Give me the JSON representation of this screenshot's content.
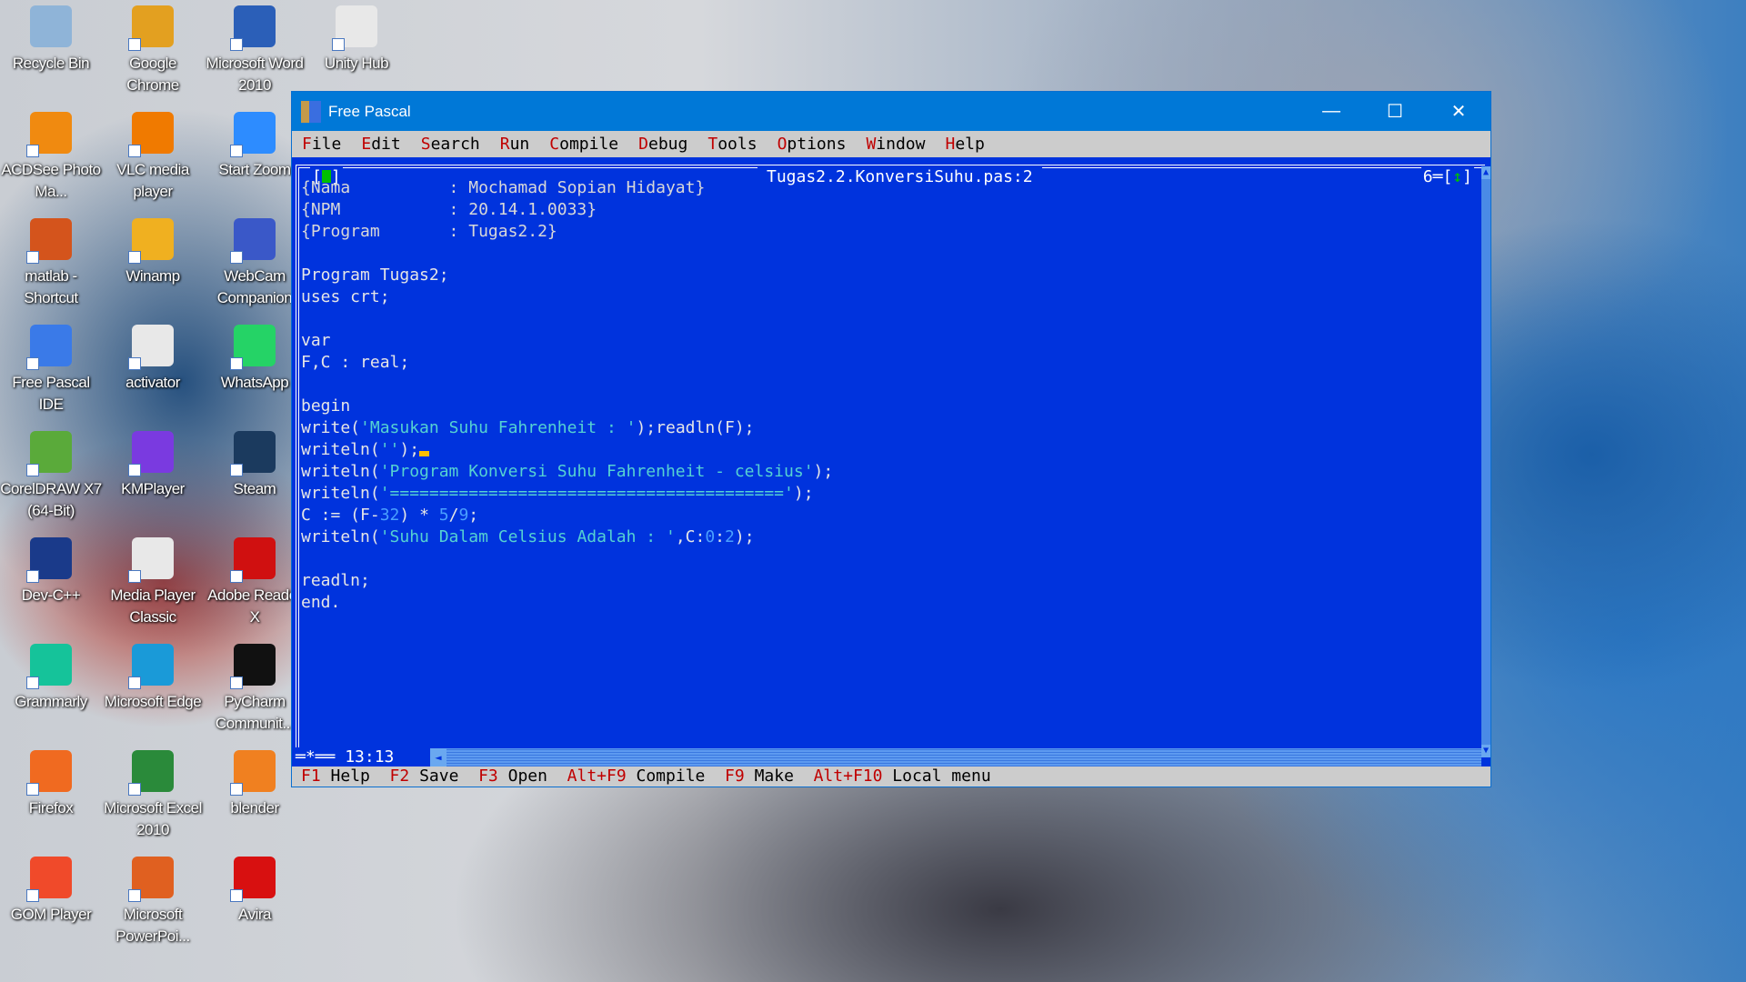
{
  "desktop": {
    "icons": [
      [
        "Recycle Bin",
        "#8fb4d8",
        "recycle-bin"
      ],
      [
        "Google Chrome",
        "#e3a020",
        "chrome"
      ],
      [
        "Microsoft Word 2010",
        "#2b5fb8",
        "word"
      ],
      [
        "Unity Hub",
        "#e8e8e8",
        "unity-hub"
      ],
      [
        "ACDSee Photo Ma...",
        "#f08a10",
        "acdsee"
      ],
      [
        "VLC media player",
        "#f07a00",
        "vlc"
      ],
      [
        "Start Zoom",
        "#2d8cff",
        "zoom"
      ],
      [
        "matlab - Shortcut",
        "#d4541c",
        "matlab"
      ],
      [
        "Winamp",
        "#f0b020",
        "winamp"
      ],
      [
        "WebCam Companion",
        "#3a58c8",
        "webcam"
      ],
      [
        "Free Pascal IDE",
        "#3a7ae8",
        "free-pascal"
      ],
      [
        "activator",
        "#e8e8e8",
        "activator"
      ],
      [
        "WhatsApp",
        "#25d366",
        "whatsapp"
      ],
      [
        "CorelDRAW X7 (64-Bit)",
        "#5aaa3a",
        "coreldraw"
      ],
      [
        "KMPlayer",
        "#7a3ae0",
        "kmplayer"
      ],
      [
        "Steam",
        "#1b3a5e",
        "steam"
      ],
      [
        "Dev-C++",
        "#1a3a8a",
        "devcpp"
      ],
      [
        "Media Player Classic",
        "#e8e8e8",
        "mpc"
      ],
      [
        "Adobe Reader X",
        "#d01010",
        "adobe-reader"
      ],
      [
        "Grammarly",
        "#15c39a",
        "grammarly"
      ],
      [
        "Microsoft Edge",
        "#1a9ad8",
        "edge"
      ],
      [
        "PyCharm Communit...",
        "#111111",
        "pycharm"
      ],
      [
        "Firefox",
        "#f06a20",
        "firefox"
      ],
      [
        "Microsoft Excel 2010",
        "#2a8a3a",
        "excel"
      ],
      [
        "blender",
        "#f08020",
        "blender"
      ],
      [
        "GOM Player",
        "#f04a2a",
        "gom-player"
      ],
      [
        "Microsoft PowerPoi...",
        "#e06020",
        "powerpoint"
      ],
      [
        "Avira",
        "#d81010",
        "avira"
      ]
    ]
  },
  "window": {
    "title": "Free Pascal",
    "minimize": "—",
    "maximize": "☐",
    "close": "✕"
  },
  "menu": [
    [
      "F",
      "ile"
    ],
    [
      "E",
      "dit"
    ],
    [
      "S",
      "earch"
    ],
    [
      "R",
      "un"
    ],
    [
      "C",
      "ompile"
    ],
    [
      "D",
      "ebug"
    ],
    [
      "T",
      "ools"
    ],
    [
      "O",
      "ptions"
    ],
    [
      "W",
      "indow"
    ],
    [
      "H",
      "elp"
    ]
  ],
  "editor": {
    "filename": "Tugas2.2.KonversiSuhu.pas:2",
    "window_number": "6",
    "cursor_position": "13:13",
    "lines": [
      [
        [
          "cmt",
          "{Nama          : Mochamad Sopian Hidayat}"
        ]
      ],
      [
        [
          "cmt",
          "{NPM           : 20.14.1.0033}"
        ]
      ],
      [
        [
          "cmt",
          "{Program       : Tugas2.2}"
        ]
      ],
      [],
      [
        [
          "t",
          "Program Tugas2;"
        ]
      ],
      [
        [
          "t",
          "uses crt;"
        ]
      ],
      [],
      [
        [
          "t",
          "var"
        ]
      ],
      [
        [
          "t",
          "F,C : real;"
        ]
      ],
      [],
      [
        [
          "t",
          "begin"
        ]
      ],
      [
        [
          "t",
          "write("
        ],
        [
          "str",
          "'Masukan Suhu Fahrenheit : '"
        ],
        [
          "t",
          ");readln(F);"
        ]
      ],
      [
        [
          "t",
          "writeln("
        ],
        [
          "str",
          "''"
        ],
        [
          "t",
          ");"
        ],
        [
          "cur",
          ""
        ]
      ],
      [
        [
          "t",
          "writeln("
        ],
        [
          "str",
          "'Program Konversi Suhu Fahrenheit - celsius'"
        ],
        [
          "t",
          ");"
        ]
      ],
      [
        [
          "t",
          "writeln("
        ],
        [
          "str",
          "'========================================'"
        ],
        [
          "t",
          ");"
        ]
      ],
      [
        [
          "t",
          "C := (F-"
        ],
        [
          "num",
          "32"
        ],
        [
          "t",
          ") * "
        ],
        [
          "num",
          "5"
        ],
        [
          "t",
          "/"
        ],
        [
          "num",
          "9"
        ],
        [
          "t",
          ";"
        ]
      ],
      [
        [
          "t",
          "writeln("
        ],
        [
          "str",
          "'Suhu Dalam Celsius Adalah : '"
        ],
        [
          "t",
          ",C:"
        ],
        [
          "num",
          "0"
        ],
        [
          "t",
          ":"
        ],
        [
          "num",
          "2"
        ],
        [
          "t",
          ");"
        ]
      ],
      [],
      [
        [
          "t",
          "readln;"
        ]
      ],
      [
        [
          "t",
          "end."
        ]
      ]
    ]
  },
  "statusbar": [
    [
      "F1",
      "Help"
    ],
    [
      "F2",
      "Save"
    ],
    [
      "F3",
      "Open"
    ],
    [
      "Alt+F9",
      "Compile"
    ],
    [
      "F9",
      "Make"
    ],
    [
      "Alt+F10",
      "Local menu"
    ]
  ],
  "colors": {
    "editor_bg": "#0033dd",
    "string": "#55d2d2",
    "number": "#4aa0ff",
    "hotkey": "#c00000",
    "titlebar": "#0078d7"
  }
}
